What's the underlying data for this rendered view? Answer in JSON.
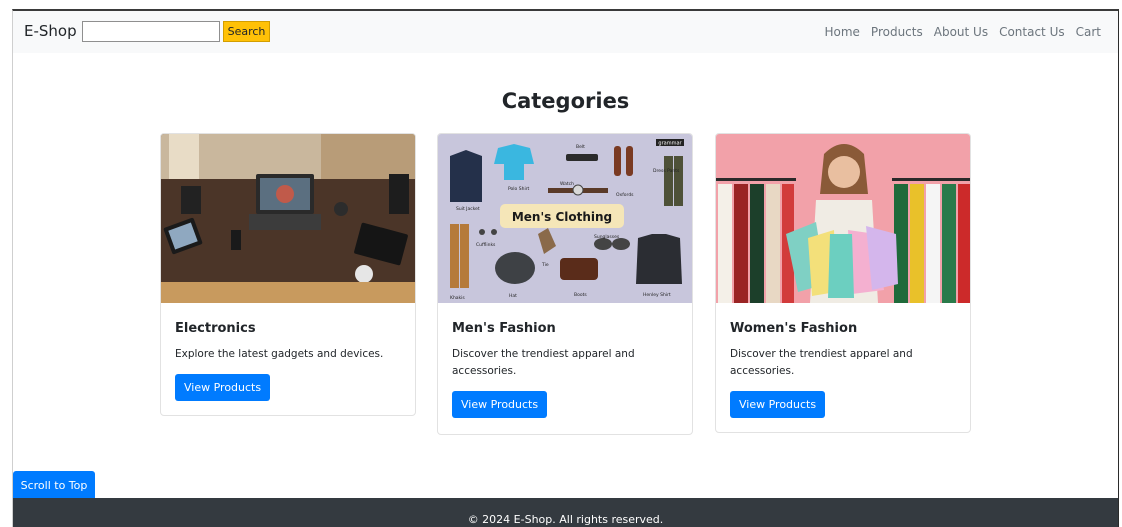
{
  "navbar": {
    "brand": "E-Shop",
    "search_placeholder": "",
    "search_label": "Search",
    "links": [
      "Home",
      "Products",
      "About Us",
      "Contact Us",
      "Cart"
    ]
  },
  "main": {
    "heading": "Categories",
    "cards": [
      {
        "title": "Electronics",
        "text": "Explore the latest gadgets and devices.",
        "button": "View Products"
      },
      {
        "title": "Men's Fashion",
        "text": "Discover the trendiest apparel and accessories.",
        "button": "View Products",
        "image_text": {
          "headline": "Men's Clothing",
          "brand": "grammar",
          "labels": [
            "Belt",
            "Polo Shirt",
            "Watch",
            "Oxfords",
            "Dress Pants",
            "Suit Jacket",
            "Cufflinks",
            "Tie",
            "Sunglasses",
            "Khakis",
            "Hat",
            "Boots",
            "Henley Shirt"
          ]
        }
      },
      {
        "title": "Women's Fashion",
        "text": "Discover the trendiest apparel and accessories.",
        "button": "View Products"
      }
    ]
  },
  "scroll_top_label": "Scroll to Top",
  "footer": {
    "text": "© 2024 E-Shop. All rights reserved."
  },
  "colors": {
    "primary": "#007bff",
    "warning": "#ffc107",
    "dark": "#343a40",
    "light": "#f8f9fa"
  }
}
